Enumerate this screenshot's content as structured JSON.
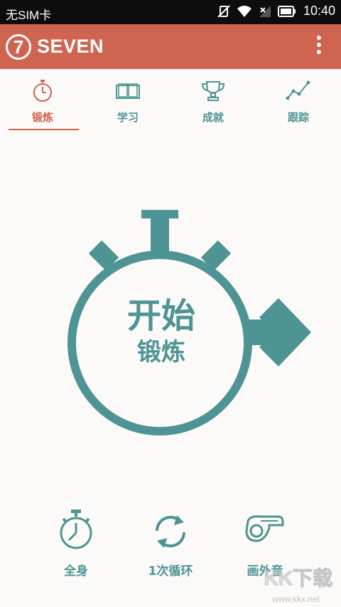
{
  "status_bar": {
    "carrier": "无SIM卡",
    "time": "10:40"
  },
  "app_bar": {
    "logo": "7",
    "title": "SEVEN",
    "menu_icon": "overflow-menu-icon"
  },
  "tabs": [
    {
      "label": "锻炼",
      "icon": "stopwatch-icon",
      "active": true
    },
    {
      "label": "学习",
      "icon": "book-icon",
      "active": false
    },
    {
      "label": "成就",
      "icon": "trophy-icon",
      "active": false
    },
    {
      "label": "跟踪",
      "icon": "chart-line-icon",
      "active": false
    }
  ],
  "start_button": {
    "line1": "开始",
    "line2": "锻炼"
  },
  "options": [
    {
      "label": "全身",
      "icon": "stopwatch-icon"
    },
    {
      "label": "1次循环",
      "icon": "refresh-icon"
    },
    {
      "label": "画外音",
      "icon": "whistle-icon"
    }
  ],
  "watermark": {
    "text": "KK下载",
    "url": "www.kkx.net"
  },
  "colors": {
    "accent": "#cf6450",
    "teal": "#4e9494",
    "background": "#fbfaf8",
    "status_bar": "#0d0d0d"
  }
}
